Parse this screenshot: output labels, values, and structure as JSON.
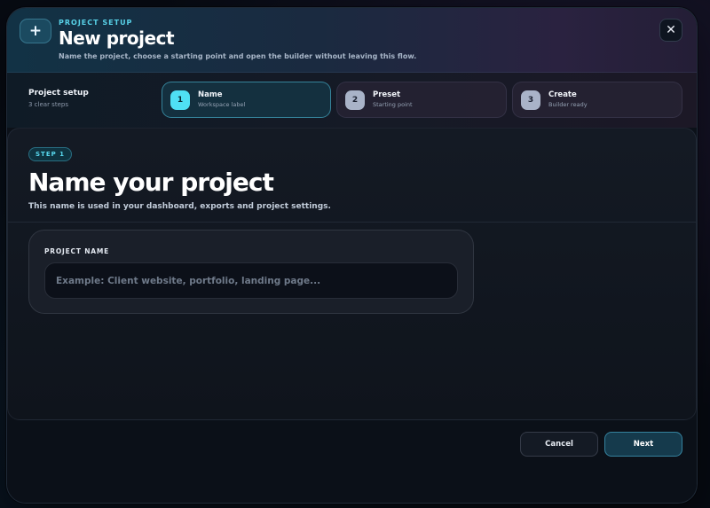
{
  "header": {
    "icon": "plus-icon",
    "icon_glyph": "+",
    "eyebrow": "PROJECT SETUP",
    "title": "New project",
    "subtitle": "Name the project, choose a starting point and open the builder without leaving this flow.",
    "close_icon": "close-icon",
    "close_glyph": "✕"
  },
  "steps": {
    "intro_label": "Project setup",
    "intro_meta": "3 clear steps",
    "items": [
      {
        "number": "1",
        "name": "Name",
        "sub": "Workspace label",
        "active": true
      },
      {
        "number": "2",
        "name": "Preset",
        "sub": "Starting point",
        "active": false
      },
      {
        "number": "3",
        "name": "Create",
        "sub": "Builder ready",
        "active": false
      }
    ]
  },
  "content": {
    "chip": "STEP 1",
    "title": "Name your project",
    "description": "This name is used in your dashboard, exports and project settings.",
    "field": {
      "label": "PROJECT NAME",
      "value": "",
      "placeholder": "Example: Client website, portfolio, landing page..."
    }
  },
  "footer": {
    "cancel_label": "Cancel",
    "next_label": "Next"
  },
  "colors": {
    "accent": "#4fe0f4",
    "eyebrow": "#58d2e8",
    "background": "#0c1119"
  }
}
